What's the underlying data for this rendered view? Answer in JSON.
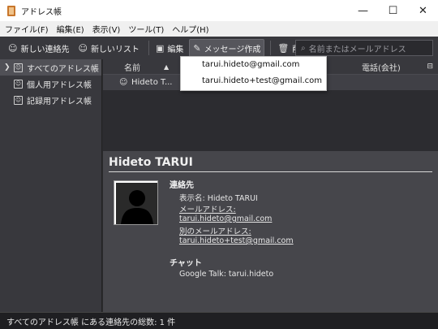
{
  "window": {
    "title": "アドレス帳",
    "minimize": "—",
    "maximize": "☐",
    "close": "✕"
  },
  "menu": [
    "ファイル(F)",
    "編集(E)",
    "表示(V)",
    "ツール(T)",
    "ヘルプ(H)"
  ],
  "toolbar": {
    "new_contact": "新しい連絡先",
    "new_list": "新しいリスト",
    "edit": "編集",
    "compose": "メッセージ作成",
    "delete": "削除",
    "search_placeholder": "名前またはメールアドレス"
  },
  "sidebar": {
    "items": [
      {
        "label": "すべてのアドレス帳"
      },
      {
        "label": "個人用アドレス帳"
      },
      {
        "label": "記録用アドレス帳"
      }
    ]
  },
  "list": {
    "columns": {
      "name": "名前",
      "company_phone": "電話(会社)"
    },
    "rows": [
      {
        "name": "Hideto T..."
      }
    ]
  },
  "dropdown": {
    "items": [
      "tarui.hideto@gmail.com",
      "tarui.hideto+test@gmail.com"
    ]
  },
  "details": {
    "name": "Hideto TARUI",
    "contact_heading": "連絡先",
    "display_name": "表示名: Hideto TARUI",
    "email_label": "メールアドレス:",
    "email": "tarui.hideto@gmail.com",
    "alt_email_label": "別のメールアドレス:",
    "alt_email": "tarui.hideto+test@gmail.com",
    "chat_heading": "チャット",
    "chat_value": "Google Talk: tarui.hideto"
  },
  "status": "すべてのアドレス帳 にある連絡先の総数: 1 件"
}
